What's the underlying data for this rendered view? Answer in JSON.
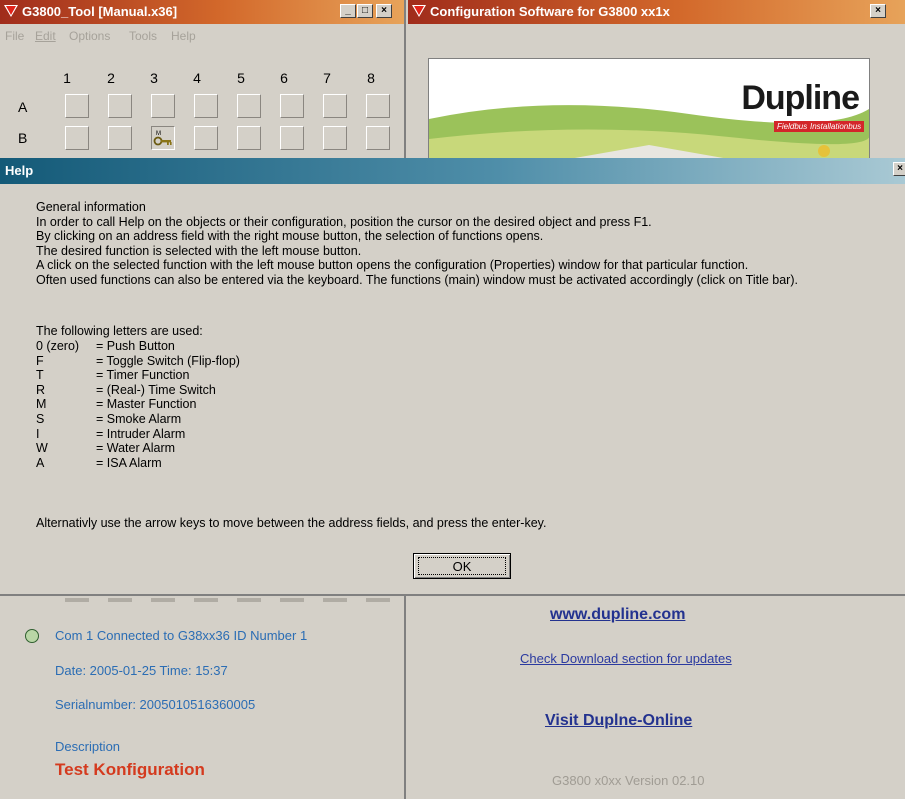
{
  "left_window": {
    "title": "G3800_Tool [Manual.x36]",
    "controls": {
      "minimize": "_",
      "maximize": "□",
      "close": "×"
    },
    "menu": [
      "File",
      "Edit",
      "Options",
      "Tools",
      "Help"
    ],
    "columns": [
      "1",
      "2",
      "3",
      "4",
      "5",
      "6",
      "7",
      "8"
    ],
    "rows": [
      "A",
      "B"
    ],
    "status": {
      "connection": "Com 1 Connected to  G38xx36 ID Number 1",
      "datetime": "Date: 2005-01-25  Time: 15:37",
      "serial": "Serialnumber: 2005010516360005",
      "description_label": "Description",
      "description_value": "Test Konfiguration",
      "led_color": "#b9d6a6"
    }
  },
  "right_window": {
    "title": "Configuration Software for G3800 xx1x",
    "close": "×",
    "logo_text": "Dupline",
    "logo_tags": [
      "Fieldbus",
      "Installationbus"
    ],
    "website_link": "www.dupline.com",
    "download_link": "Check Download section for updates",
    "online_link": "Visit Duplne-Online",
    "version": "G3800 x0xx Version 02.10"
  },
  "help_dialog": {
    "title": "Help",
    "close": "×",
    "intro": [
      "General information",
      "In order to call Help on the objects or their configuration, position the cursor on the desired object and press F1.",
      "By clicking on an address field with the right mouse button, the selection of functions opens.",
      "The desired function is selected with the left mouse button.",
      "A click on the selected function with the left mouse button opens the configuration (Properties) window for that particular function.",
      "Often used functions can also be entered via the keyboard. The functions (main) window must be activated accordingly (click on Title bar)."
    ],
    "letters_heading": "The following letters are used:",
    "letters": [
      {
        "key": "0 (zero)",
        "value": "= Push Button"
      },
      {
        "key": "F",
        "value": "= Toggle Switch (Flip-flop)"
      },
      {
        "key": "T",
        "value": "= Timer Function"
      },
      {
        "key": "R",
        "value": "= (Real-) Time Switch"
      },
      {
        "key": "M",
        "value": "= Master Function"
      },
      {
        "key": "S",
        "value": "= Smoke Alarm"
      },
      {
        "key": "I",
        "value": "= Intruder Alarm"
      },
      {
        "key": "W",
        "value": "= Water Alarm"
      },
      {
        "key": "A",
        "value": "= ISA Alarm"
      }
    ],
    "footer": "Alternativly use the arrow keys to move between the address fields, and press the enter-key.",
    "ok_label": "OK"
  }
}
